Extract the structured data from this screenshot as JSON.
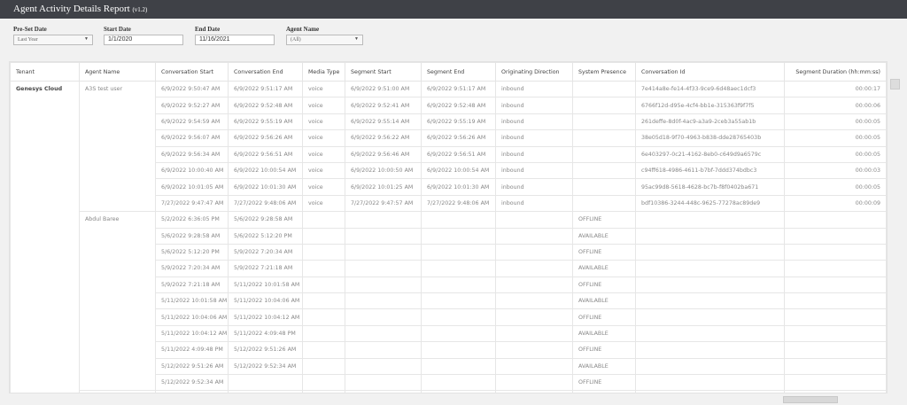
{
  "header": {
    "title": "Agent Activity Details Report",
    "version": "(v1.2)"
  },
  "filters": {
    "preset_label": "Pre-Set Date",
    "preset_value": "Last Year",
    "start_label": "Start Date",
    "start_value": "1/1/2020",
    "end_label": "End Date",
    "end_value": "11/16/2021",
    "agent_label": "Agent Name",
    "agent_value": "(All)"
  },
  "table": {
    "columns": [
      "Tenant",
      "Agent Name",
      "Conversation Start",
      "Conversation End",
      "Media Type",
      "Segment Start",
      "Segment End",
      "Originating Direction",
      "System Presence",
      "Conversation Id",
      "Segment Duration (hh:mm:ss)"
    ],
    "tenant": "Genesys Cloud",
    "groups": [
      {
        "agent": "A3S test user",
        "rows": [
          [
            "6/9/2022 9:50:47 AM",
            "6/9/2022 9:51:17 AM",
            "voice",
            "6/9/2022 9:51:00 AM",
            "6/9/2022 9:51:17 AM",
            "inbound",
            "",
            "7e414a8e-fe14-4f33-9ce9-6d48aec1dcf3",
            "00:00:17"
          ],
          [
            "6/9/2022 9:52:27 AM",
            "6/9/2022 9:52:48 AM",
            "voice",
            "6/9/2022 9:52:41 AM",
            "6/9/2022 9:52:48 AM",
            "inbound",
            "",
            "6766f12d-d95e-4cf4-bb1e-315363f9f7f5",
            "00:00:06"
          ],
          [
            "6/9/2022 9:54:59 AM",
            "6/9/2022 9:55:19 AM",
            "voice",
            "6/9/2022 9:55:14 AM",
            "6/9/2022 9:55:19 AM",
            "inbound",
            "",
            "261deffe-8d0f-4ac9-a3a9-2ceb3a55ab1b",
            "00:00:05"
          ],
          [
            "6/9/2022 9:56:07 AM",
            "6/9/2022 9:56:26 AM",
            "voice",
            "6/9/2022 9:56:22 AM",
            "6/9/2022 9:56:26 AM",
            "inbound",
            "",
            "38e05d18-9f70-4963-b838-dde28765403b",
            "00:00:05"
          ],
          [
            "6/9/2022 9:56:34 AM",
            "6/9/2022 9:56:51 AM",
            "voice",
            "6/9/2022 9:56:46 AM",
            "6/9/2022 9:56:51 AM",
            "inbound",
            "",
            "6e403297-0c21-4162-8eb0-c649d9a6579c",
            "00:00:05"
          ],
          [
            "6/9/2022 10:00:40 AM",
            "6/9/2022 10:00:54 AM",
            "voice",
            "6/9/2022 10:00:50 AM",
            "6/9/2022 10:00:54 AM",
            "inbound",
            "",
            "c94ff618-4986-4611-b7bf-7ddd374bdbc3",
            "00:00:03"
          ],
          [
            "6/9/2022 10:01:05 AM",
            "6/9/2022 10:01:30 AM",
            "voice",
            "6/9/2022 10:01:25 AM",
            "6/9/2022 10:01:30 AM",
            "inbound",
            "",
            "95ac99d8-5618-4628-bc7b-f8f0402ba671",
            "00:00:05"
          ],
          [
            "7/27/2022 9:47:47 AM",
            "7/27/2022 9:48:06 AM",
            "voice",
            "7/27/2022 9:47:57 AM",
            "7/27/2022 9:48:06 AM",
            "inbound",
            "",
            "bdf10386-3244-448c-9625-77278ac89de9",
            "00:00:09"
          ]
        ]
      },
      {
        "agent": "Abdul Baree",
        "rows": [
          [
            "5/2/2022 6:36:05 PM",
            "5/6/2022 9:28:58 AM",
            "",
            "",
            "",
            "",
            "OFFLINE",
            "",
            ""
          ],
          [
            "5/6/2022 9:28:58 AM",
            "5/6/2022 5:12:20 PM",
            "",
            "",
            "",
            "",
            "AVAILABLE",
            "",
            ""
          ],
          [
            "5/6/2022 5:12:20 PM",
            "5/9/2022 7:20:34 AM",
            "",
            "",
            "",
            "",
            "OFFLINE",
            "",
            ""
          ],
          [
            "5/9/2022 7:20:34 AM",
            "5/9/2022 7:21:18 AM",
            "",
            "",
            "",
            "",
            "AVAILABLE",
            "",
            ""
          ],
          [
            "5/9/2022 7:21:18 AM",
            "5/11/2022 10:01:58 AM",
            "",
            "",
            "",
            "",
            "OFFLINE",
            "",
            ""
          ],
          [
            "5/11/2022 10:01:58 AM",
            "5/11/2022 10:04:06 AM",
            "",
            "",
            "",
            "",
            "AVAILABLE",
            "",
            ""
          ],
          [
            "5/11/2022 10:04:06 AM",
            "5/11/2022 10:04:12 AM",
            "",
            "",
            "",
            "",
            "OFFLINE",
            "",
            ""
          ],
          [
            "5/11/2022 10:04:12 AM",
            "5/11/2022 4:09:48 PM",
            "",
            "",
            "",
            "",
            "AVAILABLE",
            "",
            ""
          ],
          [
            "5/11/2022 4:09:48 PM",
            "5/12/2022 9:51:26 AM",
            "",
            "",
            "",
            "",
            "OFFLINE",
            "",
            ""
          ],
          [
            "5/12/2022 9:51:26 AM",
            "5/12/2022 9:52:34 AM",
            "",
            "",
            "",
            "",
            "AVAILABLE",
            "",
            ""
          ],
          [
            "5/12/2022 9:52:34 AM",
            "",
            "",
            "",
            "",
            "",
            "OFFLINE",
            "",
            ""
          ]
        ]
      }
    ]
  }
}
